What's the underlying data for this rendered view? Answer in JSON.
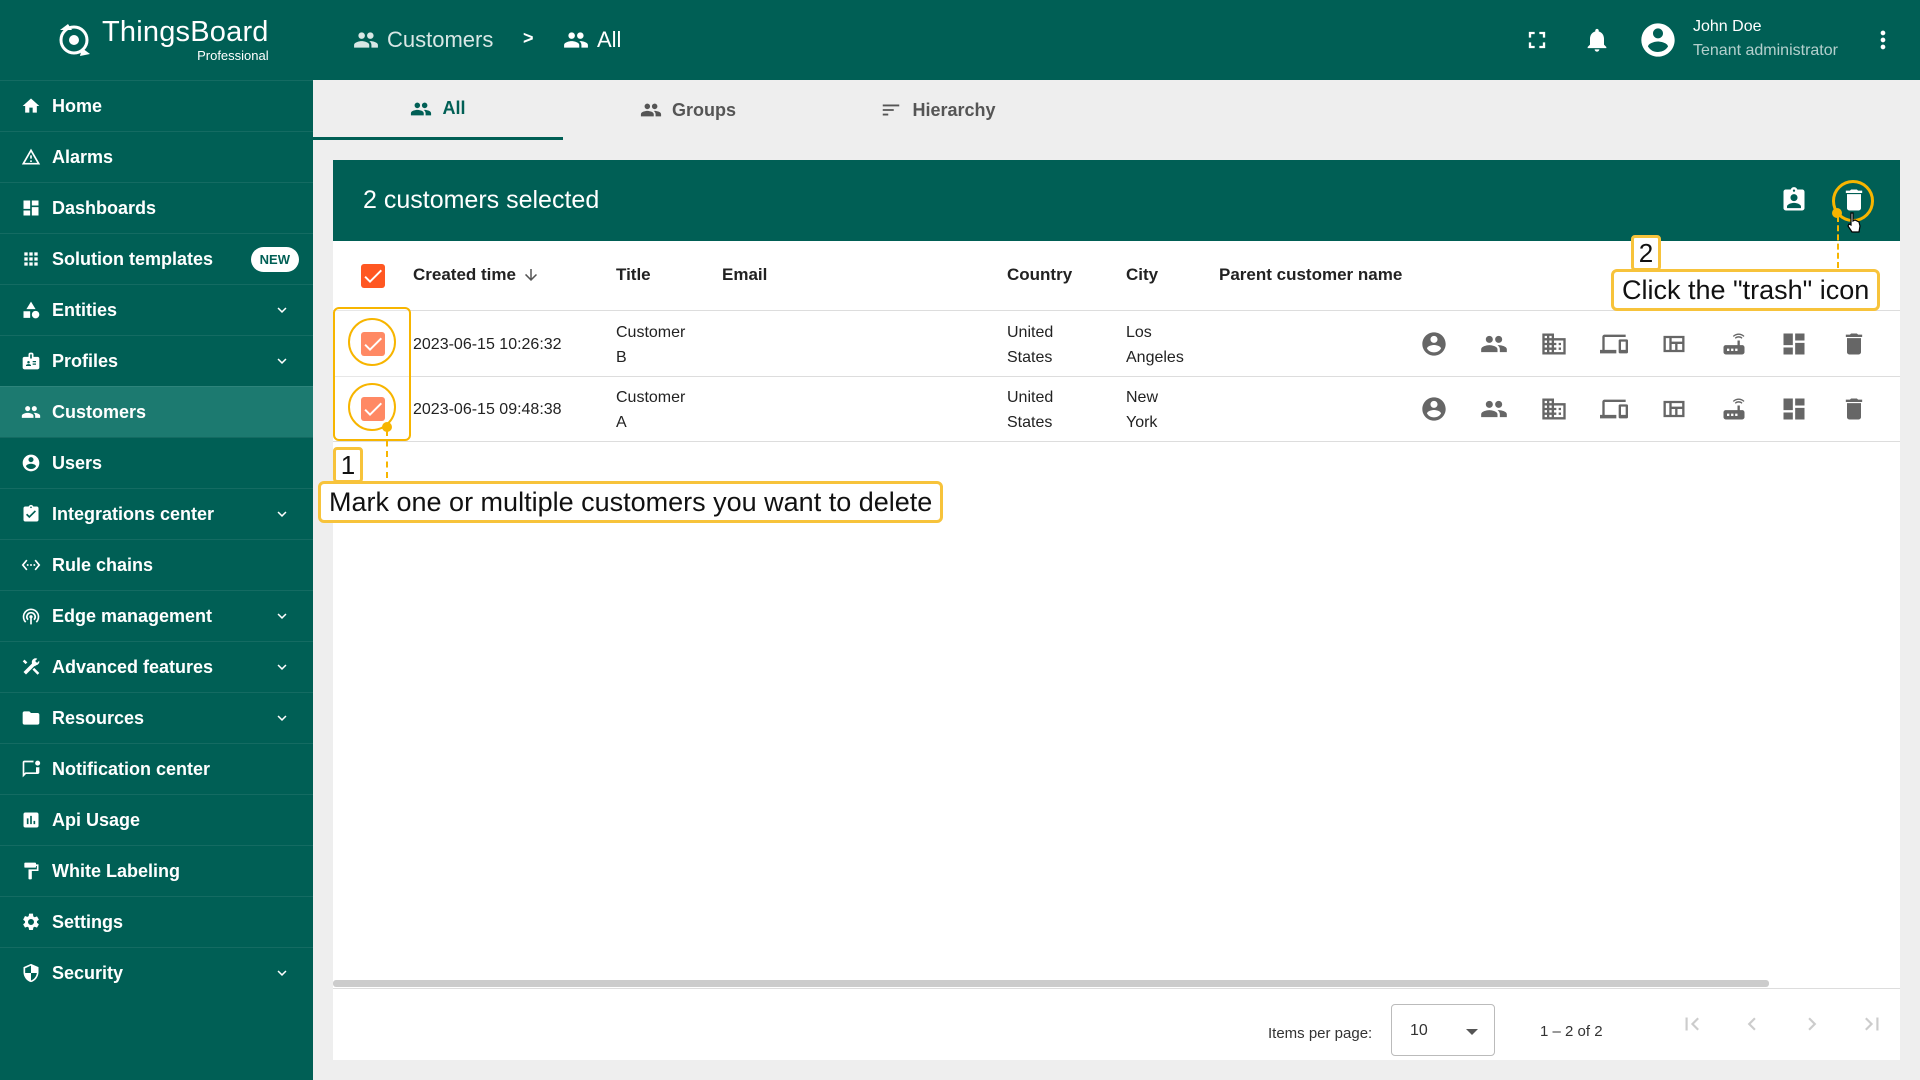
{
  "brand": {
    "name": "ThingsBoard",
    "edition": "Professional"
  },
  "sidebar": {
    "items": [
      {
        "label": "Home"
      },
      {
        "label": "Alarms"
      },
      {
        "label": "Dashboards"
      },
      {
        "label": "Solution templates",
        "badge": "NEW"
      },
      {
        "label": "Entities"
      },
      {
        "label": "Profiles"
      },
      {
        "label": "Customers"
      },
      {
        "label": "Users"
      },
      {
        "label": "Integrations center"
      },
      {
        "label": "Rule chains"
      },
      {
        "label": "Edge management"
      },
      {
        "label": "Advanced features"
      },
      {
        "label": "Resources"
      },
      {
        "label": "Notification center"
      },
      {
        "label": "Api Usage"
      },
      {
        "label": "White Labeling"
      },
      {
        "label": "Settings"
      },
      {
        "label": "Security"
      }
    ]
  },
  "breadcrumb": {
    "first": "Customers",
    "separator": ">",
    "second": "All"
  },
  "user": {
    "name": "John Doe",
    "role": "Tenant administrator"
  },
  "tabs": [
    {
      "label": "All"
    },
    {
      "label": "Groups"
    },
    {
      "label": "Hierarchy"
    }
  ],
  "selection": {
    "title": "2 customers selected"
  },
  "table": {
    "columns": [
      "Created time",
      "Title",
      "Email",
      "Country",
      "City",
      "Parent customer name"
    ],
    "rows": [
      {
        "created": "2023-06-15 10:26:32",
        "title_1": "Customer",
        "title_2": "B",
        "email": "",
        "country_1": "United",
        "country_2": "States",
        "city_1": "Los",
        "city_2": "Angeles",
        "parent": ""
      },
      {
        "created": "2023-06-15 09:48:38",
        "title_1": "Customer",
        "title_2": "A",
        "email": "",
        "country_1": "United",
        "country_2": "States",
        "city_1": "New",
        "city_2": "York",
        "parent": ""
      }
    ]
  },
  "pagination": {
    "items_per_page_label": "Items per page:",
    "items_per_page": "10",
    "range": "1 – 2 of 2"
  },
  "annotations": {
    "step1_num": "1",
    "step1_text": "Mark one or multiple customers you want to delete",
    "step2_num": "2",
    "step2_text": "Click the \"trash\" icon"
  },
  "colors": {
    "primary": "#005f55",
    "accent": "#ff5722",
    "annotation": "#f7b500"
  }
}
